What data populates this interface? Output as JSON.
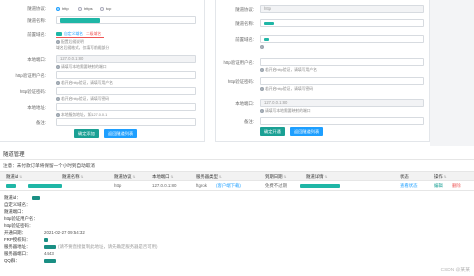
{
  "left_form": {
    "fields": [
      {
        "label": "隧道协议:"
      },
      {
        "label": "隧道名称:"
      },
      {
        "label": "前置域名:"
      },
      {
        "label": "本地端口:"
      },
      {
        "label": "http验证用户名:"
      },
      {
        "label": "http验证密码:"
      },
      {
        "label": "本地地址:"
      },
      {
        "label": "备注:"
      }
    ],
    "protocol_options": [
      "http",
      "https",
      "tcp"
    ],
    "domain_tags": [
      "自定义域名",
      "二级域名"
    ],
    "domain_tip": "配置后缀说明",
    "domain_hint": "域名后缀格式，仅填写前缀部分",
    "port_placeholder": "127.0.0.1:80",
    "port_hint": "请填写本地需要映射的端口",
    "user_hint": "若开启http验证，请填写用户名",
    "pass_hint": "若开启http验证，请填写密码",
    "addr_hint": "本地服务地址，如127.0.0.1",
    "submit_label": "确定添加",
    "cancel_label": "返回隧道列表"
  },
  "right_form": {
    "fields": [
      {
        "label": "隧道协议:"
      },
      {
        "label": "隧道名称:"
      },
      {
        "label": "前置域名:"
      },
      {
        "label": "http验证用户名:"
      },
      {
        "label": "http验证密码:"
      },
      {
        "label": "本地端口:"
      },
      {
        "label": "备注:"
      }
    ],
    "protocol_value": "http",
    "user_hint": "若开启http验证，请填写用户名",
    "pass_hint": "若开启http验证，请填写密码",
    "port_placeholder": "127.0.0.1:80",
    "port_hint": "请填写本地需要映射的端口",
    "submit_label": "确定开通",
    "cancel_label": "返回隧道列表"
  },
  "section": {
    "title": "隧道管理",
    "note": "注意：未付款订单将保留一个小时到自动取消"
  },
  "table": {
    "headers": [
      "隧道id",
      "隧道名称",
      "隧道协议",
      "本地端口",
      "服务器类型",
      "到期日期",
      "隧道详情",
      "状态",
      "操作"
    ],
    "row": {
      "protocol": "http",
      "port": "127.0.0.1:80",
      "server": "ftgrok",
      "server_link": "(客户端下载)",
      "expire": "免费不过期",
      "status": "查看状态",
      "edit": "编辑",
      "delete": "删除"
    }
  },
  "details": [
    {
      "label": "隧道id：",
      "value": ""
    },
    {
      "label": "自定义域名：",
      "value": ""
    },
    {
      "label": "隧道端口：",
      "value": ""
    },
    {
      "label": "http验证用户名：",
      "value": ""
    },
    {
      "label": "http验证密码：",
      "value": ""
    },
    {
      "label": "开通日期：",
      "value": "2021-02-27 09:54:32"
    },
    {
      "label": "FRP授权码：",
      "value": ""
    },
    {
      "label": "服务器地址：",
      "value": "(请不要直接复制此地址，请先确定服务器是否可用)"
    },
    {
      "label": "服务器端口：",
      "value": "4443"
    },
    {
      "label": "QQ群：",
      "value": ""
    }
  ],
  "watermark": "CSDN @某某",
  "colors": {
    "accent": "#1e9fff",
    "green": "#1aa094",
    "redact": "#1fb6a6"
  }
}
